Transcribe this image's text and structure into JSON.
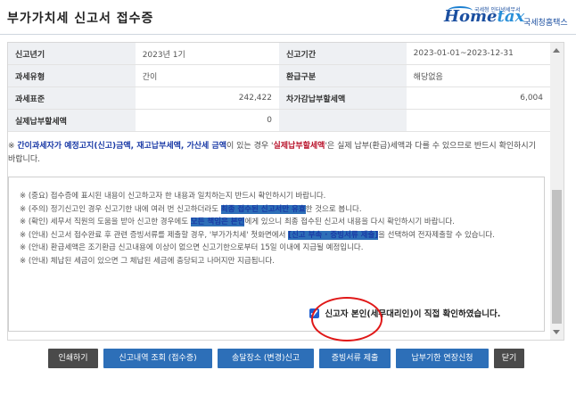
{
  "header": {
    "title": "부가가치세 신고서 접수증",
    "logo_home": "Home",
    "logo_tax": "tax",
    "logo_sub": "국세청 인터넷세무서",
    "logo_nts": "국세청홈택스"
  },
  "info_table": {
    "rows": [
      [
        {
          "label": "신고년기",
          "value": "2023년 1기"
        },
        {
          "label": "신고기간",
          "value": "2023-01-01~2023-12-31"
        }
      ],
      [
        {
          "label": "과세유형",
          "value": "간이"
        },
        {
          "label": "환급구분",
          "value": "해당없음"
        }
      ],
      [
        {
          "label": "과세표준",
          "value": "242,422"
        },
        {
          "label": "차가감납부할세액",
          "value": "6,004"
        }
      ],
      [
        {
          "label": "실제납부할세액",
          "value": "0"
        }
      ]
    ]
  },
  "notice": {
    "prefix": "※ ",
    "hl1": "간이과세자가 예정고지(신고)금액, 재고납부세액, 가산세 금액",
    "mid": "이 있는 경우 '",
    "hl2": "실제납부할세액",
    "suffix": "'은 실제 납부(환급)세액과 다를 수 있으므로 반드시 확인하시기 바랍니다."
  },
  "messages": [
    {
      "a": "※ (중요) 접수증에 표시된 내용이 신고하고자 한 내용과 일치하는지 반드시 확인하시기 바랍니다.",
      "b": "",
      "c": ""
    },
    {
      "a": "※ (주의) 정기신고인 경우 신고기한 내에 여러 번 신고하더라도 ",
      "b": "최종 접수된 신고서만 유효",
      "c": "한 것으로 봅니다."
    },
    {
      "a": "※ (확인) 세무서 직원의 도움을 받아 신고한 경우에도 ",
      "b": "모든 책임은 본인",
      "c": "에게 있으니 최종 접수된 신고서 내용을 다시 확인하시기 바랍니다."
    },
    {
      "a": "※ (안내) 신고서 접수완료 후 관련 증빙서류를 제출할 경우, '부가가치세' 첫화면에서 ",
      "b": "[신고 부속 · 증빙서류 제출]",
      "c": "을 선택하여 전자제출할 수 있습니다."
    },
    {
      "a": "※ (안내) 환급세액은 조기환급 신고내용에 이상이 없으면 신고기한으로부터 15일 이내에 지급될 예정입니다.",
      "b": "",
      "c": ""
    },
    {
      "a": "※ (안내) 체납된 세금이 있으면 그 체납된 세금에 충당되고 나머지만 지급됩니다.",
      "b": "",
      "c": ""
    }
  ],
  "confirm_label": "신고자 본인(세무대리인)이 직접 확인하였습니다.",
  "buttons": {
    "print": "인쇄하기",
    "history": "신고내역 조회 (접수증)",
    "address": "송달장소 (변경)신고",
    "evidence": "증빙서류 제출",
    "extension": "납부기한 연장신청",
    "close": "닫기"
  },
  "colors": {
    "accent_blue": "#2d6fb8",
    "dark_button": "#4a4a4a",
    "annotation_red": "#e01818",
    "highlight_red": "#b8122a"
  }
}
